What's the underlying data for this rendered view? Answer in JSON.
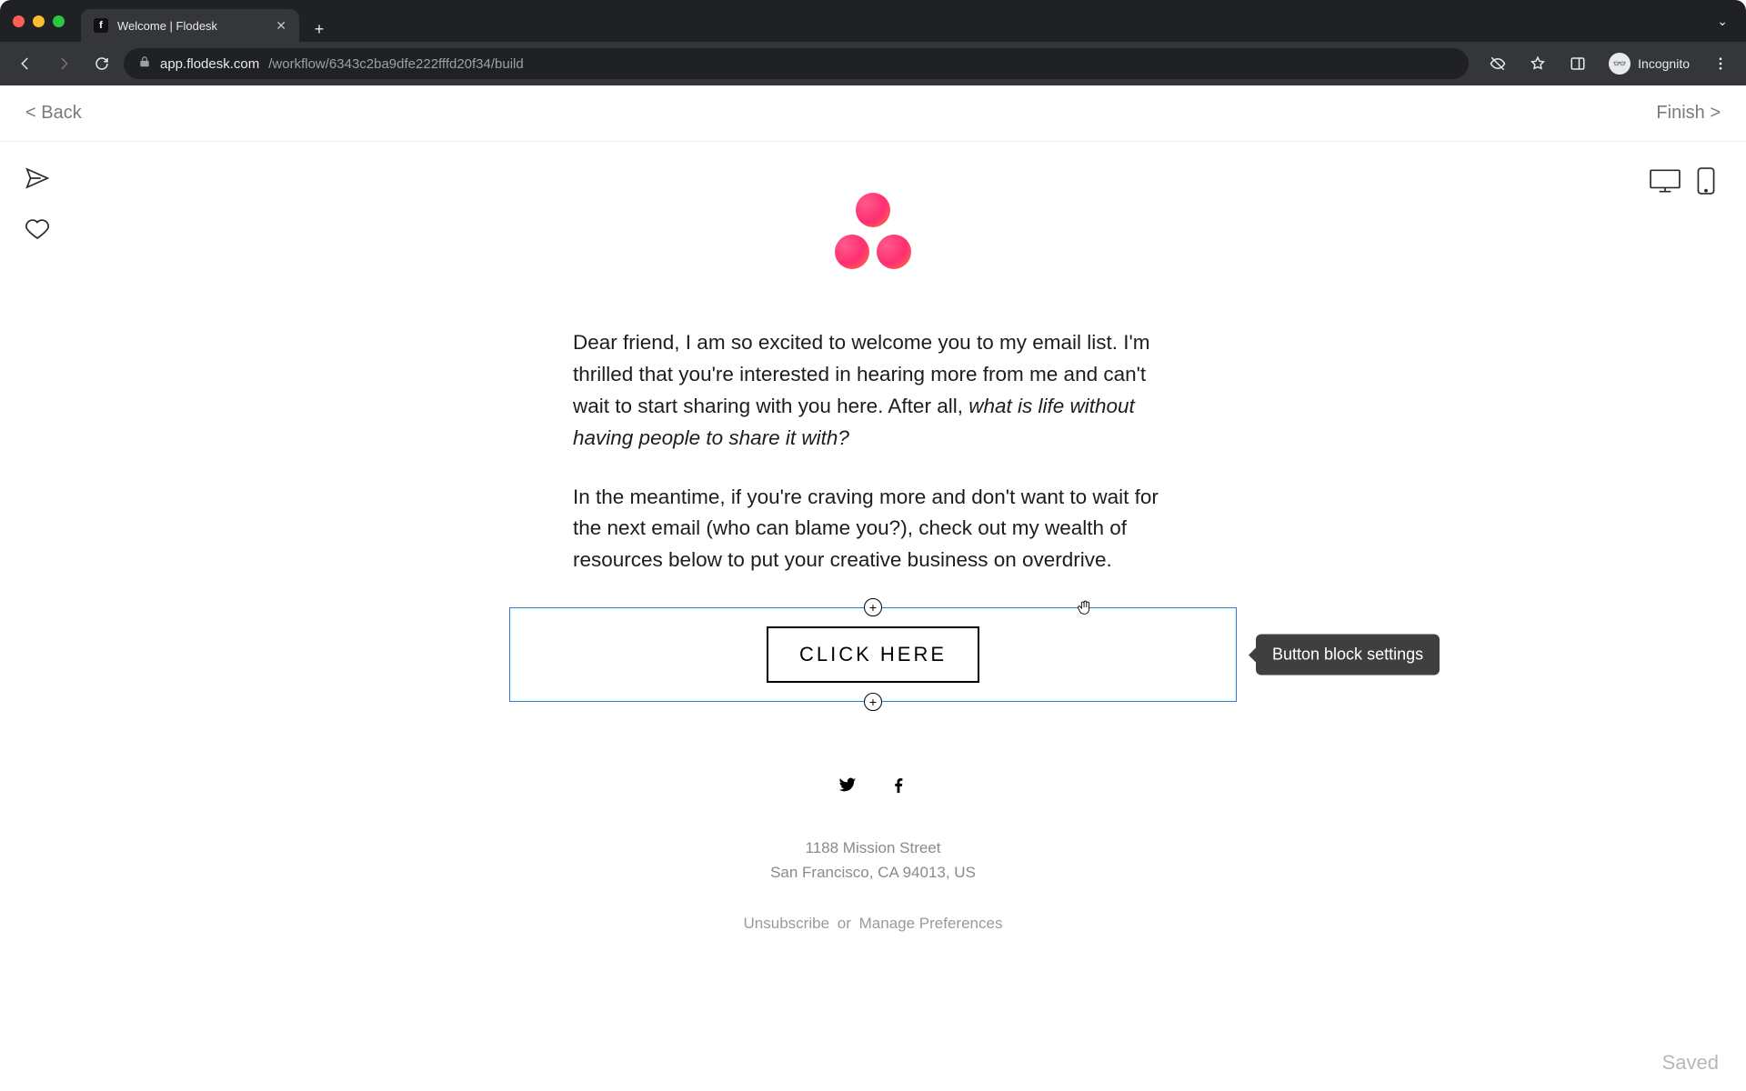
{
  "browser": {
    "tab_title": "Welcome | Flodesk",
    "url_host": "app.flodesk.com",
    "url_path": "/workflow/6343c2ba9dfe222fffd20f34/build",
    "incognito_label": "Incognito"
  },
  "header": {
    "back": "< Back",
    "finish": "Finish >"
  },
  "email": {
    "para1_plain": "Dear friend, I am so excited to welcome you to my email list. I'm thrilled that you're interested in hearing more from me and can't wait to start sharing with you here. After all, ",
    "para1_italic": "what is life without having people to share it with?",
    "para2": "In the meantime, if you're craving more and don't want to wait for the next email (who can blame you?), check out my wealth of resources below to put your creative business on overdrive.",
    "cta_label": "CLICK HERE",
    "tooltip": "Button block settings",
    "address_line1": "1188 Mission Street",
    "address_line2": "San Francisco, CA 94013, US",
    "unsubscribe": "Unsubscribe",
    "or": "or",
    "manage": "Manage Preferences"
  },
  "status": {
    "saved": "Saved"
  }
}
